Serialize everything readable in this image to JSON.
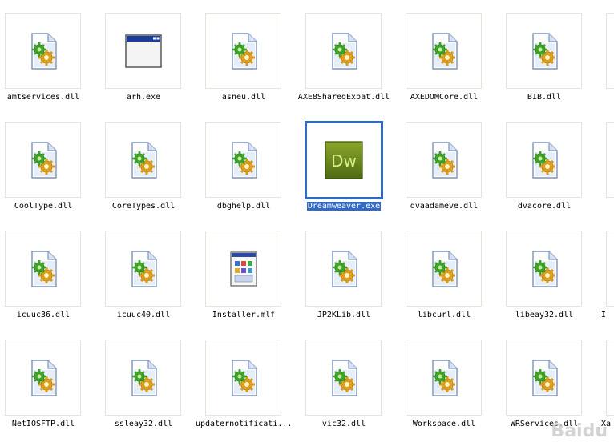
{
  "items": [
    {
      "label": "amtservices.dll",
      "icon": "dll-gear-icon"
    },
    {
      "label": "arh.exe",
      "icon": "exe-window-icon"
    },
    {
      "label": "asneu.dll",
      "icon": "dll-gear-icon"
    },
    {
      "label": "AXE8SharedExpat.dll",
      "icon": "dll-gear-icon"
    },
    {
      "label": "AXEDOMCore.dll",
      "icon": "dll-gear-icon"
    },
    {
      "label": "BIB.dll",
      "icon": "dll-gear-icon"
    },
    {
      "label": "CoolType.dll",
      "icon": "dll-gear-icon"
    },
    {
      "label": "CoreTypes.dll",
      "icon": "dll-gear-icon"
    },
    {
      "label": "dbghelp.dll",
      "icon": "dll-gear-icon"
    },
    {
      "label": "Dreamweaver.exe",
      "icon": "dreamweaver-app-icon",
      "selected": true
    },
    {
      "label": "dvaadameve.dll",
      "icon": "dll-gear-icon"
    },
    {
      "label": "dvacore.dll",
      "icon": "dll-gear-icon"
    },
    {
      "label": "icuuc36.dll",
      "icon": "dll-gear-icon"
    },
    {
      "label": "icuuc40.dll",
      "icon": "dll-gear-icon"
    },
    {
      "label": "Installer.mlf",
      "icon": "installer-file-icon"
    },
    {
      "label": "JP2KLib.dll",
      "icon": "dll-gear-icon"
    },
    {
      "label": "libcurl.dll",
      "icon": "dll-gear-icon"
    },
    {
      "label": "libeay32.dll",
      "icon": "dll-gear-icon"
    },
    {
      "label": "NetIOSFTP.dll",
      "icon": "dll-gear-icon"
    },
    {
      "label": "ssleay32.dll",
      "icon": "dll-gear-icon"
    },
    {
      "label": "updaternotificati...",
      "icon": "dll-gear-icon"
    },
    {
      "label": "vic32.dll",
      "icon": "dll-gear-icon"
    },
    {
      "label": "Workspace.dll",
      "icon": "dll-gear-icon"
    },
    {
      "label": "WRServices.dll",
      "icon": "dll-gear-icon"
    }
  ],
  "edge_labels": [
    "",
    "",
    "I",
    "Xa"
  ],
  "dreamweaver_text": "Dw",
  "colors": {
    "selection": "#316ac5",
    "dw_green": "#6b8a1c"
  },
  "watermark": "Baidu"
}
